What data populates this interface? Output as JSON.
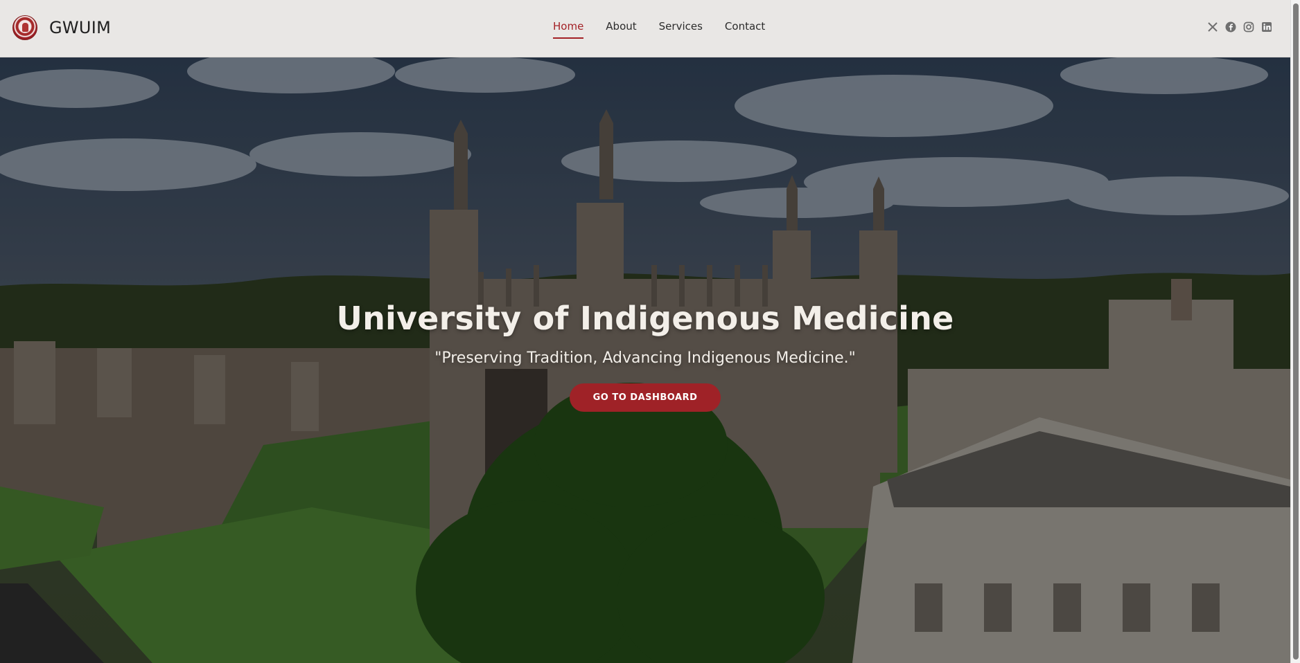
{
  "brand": {
    "name": "GWUIM",
    "logo_icon": "university-seal-icon"
  },
  "nav": {
    "items": [
      {
        "label": "Home",
        "active": true
      },
      {
        "label": "About",
        "active": false
      },
      {
        "label": "Services",
        "active": false
      },
      {
        "label": "Contact",
        "active": false
      }
    ]
  },
  "social": {
    "icons": [
      "x-icon",
      "facebook-icon",
      "instagram-icon",
      "linkedin-icon"
    ]
  },
  "hero": {
    "title": "University of Indigenous Medicine",
    "subtitle": "\"Preserving Tradition, Advancing Indigenous Medicine.\"",
    "button_label": "GO TO DASHBOARD"
  },
  "colors": {
    "accent": "#a32126",
    "header_bg": "#e9e7e5",
    "hero_text": "#f3efe9"
  }
}
